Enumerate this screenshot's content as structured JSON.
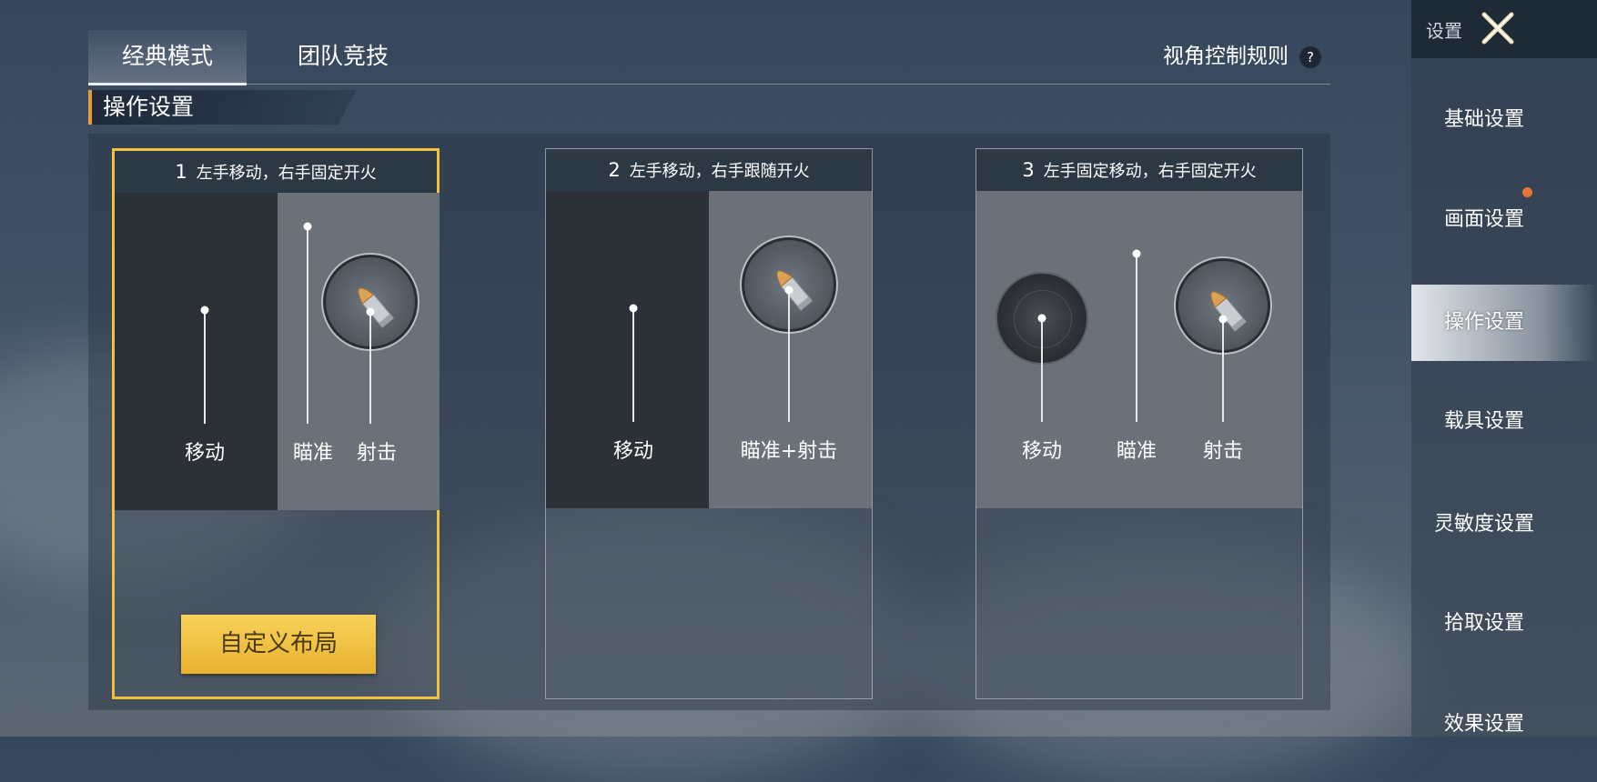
{
  "tabs": [
    {
      "label": "经典模式",
      "active": true
    },
    {
      "label": "团队竞技",
      "active": false
    }
  ],
  "rules": {
    "label": "视角控制规则",
    "help": "?"
  },
  "section": {
    "title": "操作设置"
  },
  "cards": [
    {
      "num": "1",
      "title": "左手移动，右手固定开火",
      "selected": true,
      "labels": {
        "move": "移动",
        "aim": "瞄准",
        "shoot": "射击"
      },
      "button": "自定义布局"
    },
    {
      "num": "2",
      "title": "左手移动，右手跟随开火",
      "selected": false,
      "labels": {
        "move": "移动",
        "aim_shoot": "瞄准+射击"
      }
    },
    {
      "num": "3",
      "title": "左手固定移动，右手固定开火",
      "selected": false,
      "labels": {
        "move": "移动",
        "aim": "瞄准",
        "shoot": "射击"
      }
    }
  ],
  "sidebar": {
    "title": "设置",
    "items": [
      {
        "label": "基础设置"
      },
      {
        "label": "画面设置",
        "notification": true
      },
      {
        "label": "操作设置",
        "active": true
      },
      {
        "label": "载具设置"
      },
      {
        "label": "灵敏度设置"
      },
      {
        "label": "拾取设置"
      },
      {
        "label": "效果设置"
      }
    ]
  },
  "colors": {
    "accent": "#f0c23b",
    "section_bar": "#e69b3a",
    "notification": "#e8743a"
  }
}
